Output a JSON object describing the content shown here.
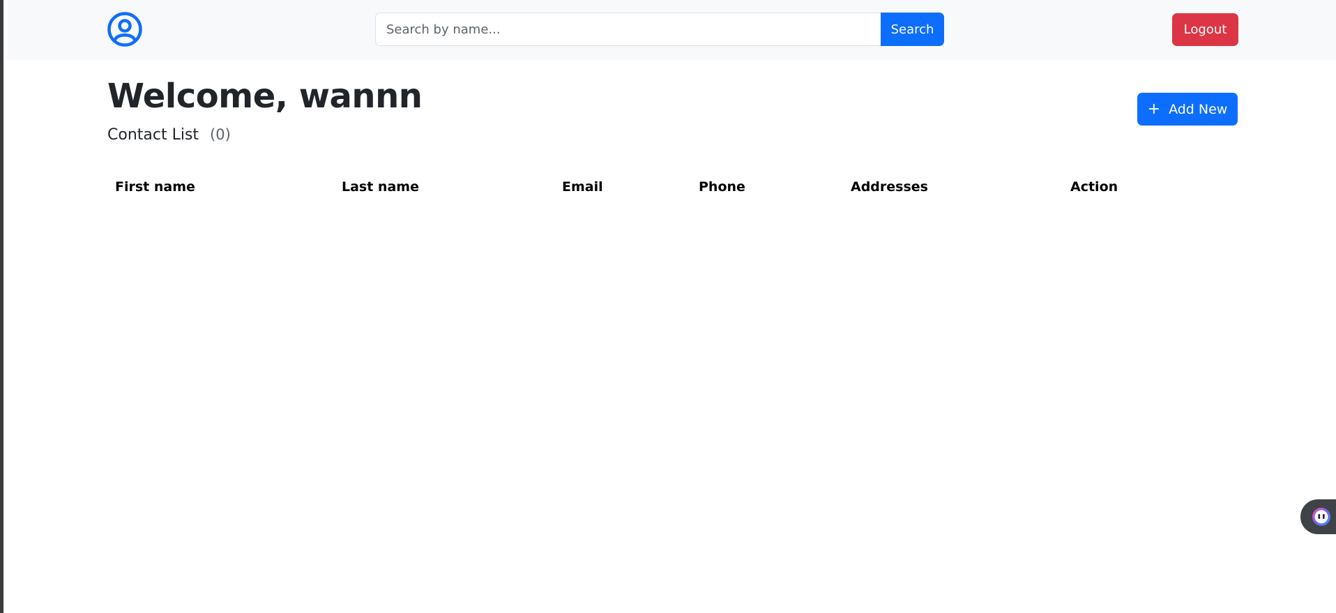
{
  "header": {
    "search": {
      "placeholder": "Search by name...",
      "value": "",
      "button_label": "Search"
    },
    "logout_label": "Logout"
  },
  "main": {
    "title": "Welcome, wannn",
    "subtitle": "Contact List",
    "count": "(0)",
    "add_label": "Add New"
  },
  "table": {
    "columns": [
      "First name",
      "Last name",
      "Email",
      "Phone",
      "Addresses",
      "Action"
    ],
    "rows": []
  },
  "colors": {
    "primary": "#0d6efd",
    "danger": "#dc3545",
    "navbar_bg": "#f8f9fa"
  },
  "icons": {
    "logo": "person-circle-icon",
    "add": "plus-icon",
    "widget": "chat-bot-icon"
  }
}
